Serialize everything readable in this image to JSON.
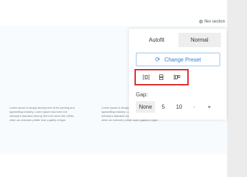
{
  "section_tag": {
    "icon": "gear-icon",
    "label": "flex section"
  },
  "content": {
    "paragraphs": [
      "Lorem Ipsum is simply dummy text of the printing and typesetting industry. Lorem Ipsum has been the industry's standard dummy text ever since the 1500s, when an unknown printer took a galley of type.",
      "Lorem Ipsum is simply dummy text of the printing and typesetting industry. Lorem Ipsum has been the industry's standard dummy text ever since the 1500s, when an unknown printer took a galley of type."
    ]
  },
  "panel": {
    "fit_options": [
      {
        "label": "Autofit",
        "selected": false
      },
      {
        "label": "Normal",
        "selected": true
      }
    ],
    "change_preset": {
      "icon": "refresh-icon",
      "label": "Change Preset"
    },
    "alignment_icons": [
      "align-space-around-icon",
      "align-center-icon",
      "align-start-icon"
    ],
    "gap": {
      "label": "Gap:",
      "options": [
        "None",
        "5",
        "10"
      ],
      "selected": "None",
      "decrement": "-",
      "increment": "+"
    }
  },
  "colors": {
    "accent": "#2f7fd6",
    "highlight_border": "#e02525",
    "section_background": "#f7fbfd",
    "selected_option": "#eeeeee"
  }
}
